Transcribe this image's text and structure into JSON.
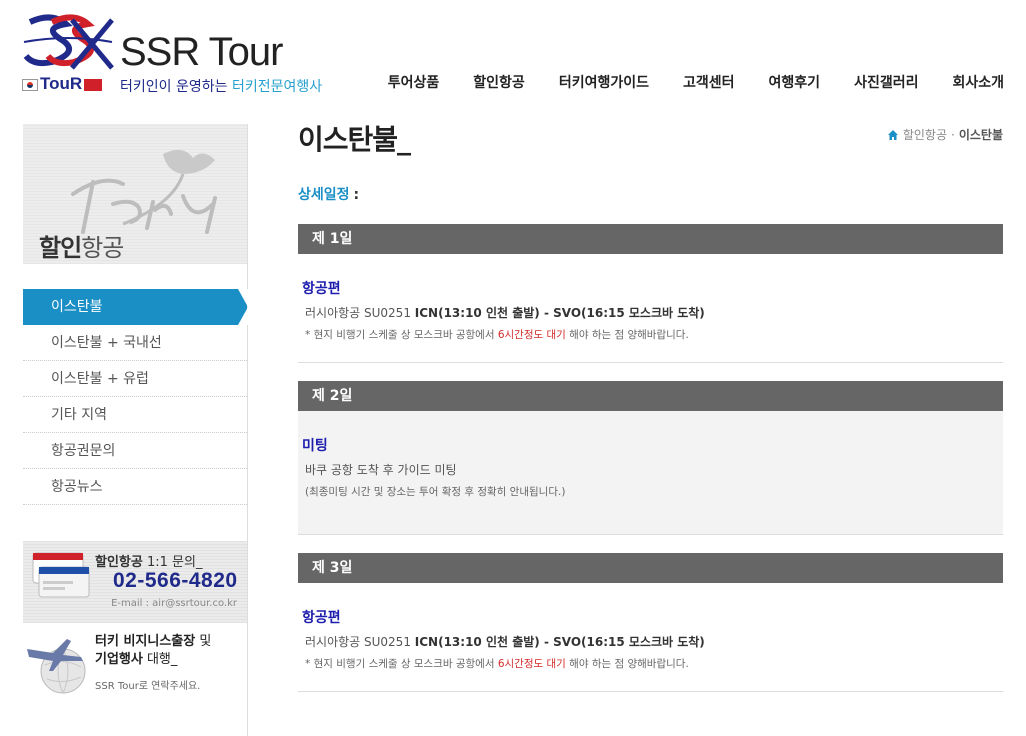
{
  "header": {
    "logo_title": "SSR Tour",
    "logo_small": "TouR",
    "slogan_prefix": "터키인이 운영하는 ",
    "slogan_highlight": "터키전문여행사",
    "nav": [
      "투어상품",
      "할인항공",
      "터키여행가이드",
      "고객센터",
      "여행후기",
      "사진갤러리",
      "회사소개"
    ]
  },
  "sidebar": {
    "title_bold": "할인",
    "title_light": "항공",
    "menu": [
      "이스탄불",
      "이스탄불 + 국내선",
      "이스탄불 + 유럽",
      "기타 지역",
      "항공권문의",
      "항공뉴스"
    ],
    "contact": {
      "title_bold": "할인항공",
      "title_rest": " 1:1 문의_",
      "phone": "02-566-4820",
      "email": "E-mail : air@ssrtour.co.kr"
    },
    "biz": {
      "line1": "터키 비지니스출장",
      "line1_tail": " 및",
      "line2": "기업행사",
      "line2_tail": " 대행_",
      "sub": "SSR Tour로 연락주세요."
    }
  },
  "main": {
    "title": "이스탄불_",
    "breadcrumb": [
      "할인항공",
      "이스탄불"
    ],
    "breadcrumb_sep": "·",
    "detail_label": "상세일정",
    "detail_colon": ":",
    "days": [
      {
        "label": "제 1일",
        "item_title": "항공편",
        "line_prefix": "러시아항공 SU0251 ",
        "line_bold": "ICN(13:10 인천 출발) - SVO(16:15 모스크바 도착)",
        "note_pre": "* 현지 비행기 스케줄 상 모스크바 공항에서 ",
        "note_red": "6시간정도 대기",
        "note_post": " 해야 하는 점 양해바랍니다."
      },
      {
        "label": "제 2일",
        "item_title": "미팅",
        "line": "바쿠 공항 도착 후 가이드 미팅",
        "note": "(최종미팅 시간 및 장소는 투어 확정 후 정확히 안내됩니다.)"
      },
      {
        "label": "제 3일",
        "item_title": "항공편",
        "line_prefix": "러시아항공 SU0251 ",
        "line_bold": "ICN(13:10 인천 출발) - SVO(16:15 모스크바 도착)",
        "note_pre": "* 현지 비행기 스케줄 상 모스크바 공항에서 ",
        "note_red": "6시간정도 대기",
        "note_post": " 해야 하는 점 양해바랍니다."
      }
    ]
  },
  "colors": {
    "accent": "#1a8fc6",
    "day_bar": "#666666",
    "brand": "#1f2a8a",
    "note_red": "#d42a2a"
  }
}
